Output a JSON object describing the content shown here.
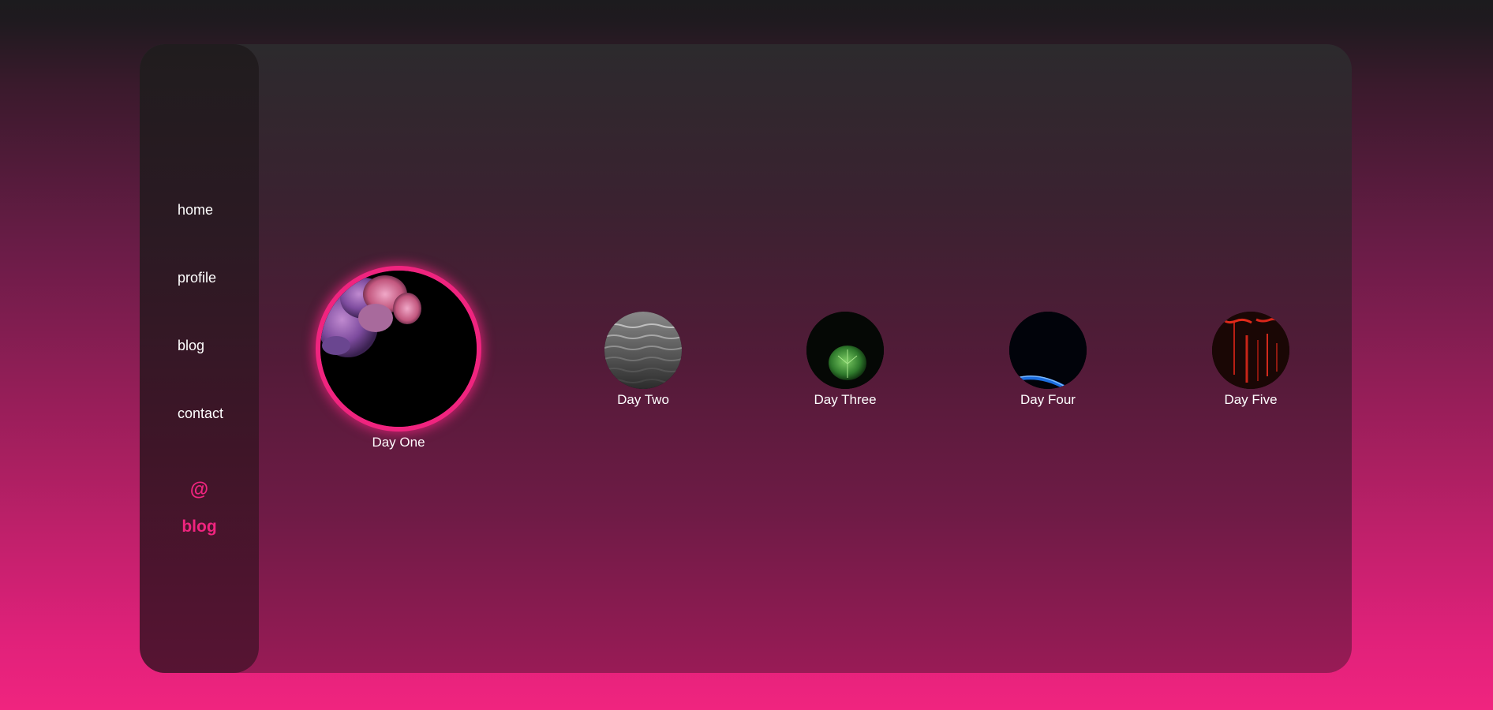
{
  "nav": {
    "items": [
      {
        "label": "home"
      },
      {
        "label": "profile"
      },
      {
        "label": "blog"
      },
      {
        "label": "contact"
      }
    ]
  },
  "brand": {
    "symbol": "@",
    "text": "blog",
    "color": "#f0247f"
  },
  "stories": [
    {
      "label": "Day One",
      "image": "purple-pink-smoke",
      "active": true
    },
    {
      "label": "Day Two",
      "image": "gray-water-ripples",
      "active": false
    },
    {
      "label": "Day Three",
      "image": "green-leaf-on-black",
      "active": false
    },
    {
      "label": "Day Four",
      "image": "blue-light-streak",
      "active": false
    },
    {
      "label": "Day Five",
      "image": "red-light-trails",
      "active": false
    }
  ]
}
